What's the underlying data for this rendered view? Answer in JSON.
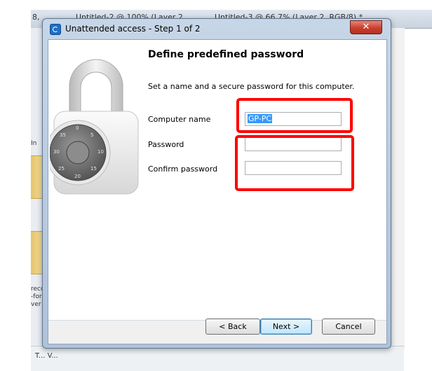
{
  "background_app": {
    "tabs": [
      "8,",
      "Untitled-2 @ 100% (Layer 2,",
      "Untitled-3 @ 66.7% (Layer 2, RGB/8) *"
    ],
    "side_labels": [
      "In",
      "recc",
      "-for",
      "ver"
    ],
    "bottom_label": "T... V..."
  },
  "dialog": {
    "title": "Unattended access - Step 1 of 2",
    "close_glyph": "✕",
    "heading": "Define predefined password",
    "description": "Set a name and a secure password for this computer.",
    "fields": {
      "computer_name": {
        "label": "Computer name",
        "value": "GP-PC"
      },
      "password": {
        "label": "Password",
        "value": ""
      },
      "confirm_password": {
        "label": "Confirm password",
        "value": ""
      }
    },
    "buttons": {
      "back": "< Back",
      "next": "Next >",
      "cancel": "Cancel"
    },
    "icons": {
      "window": "teamviewer-icon",
      "hero": "combination-lock-icon"
    },
    "colors": {
      "highlight": "#ff0000",
      "selection": "#3399ff",
      "close": "#c9402f"
    }
  }
}
